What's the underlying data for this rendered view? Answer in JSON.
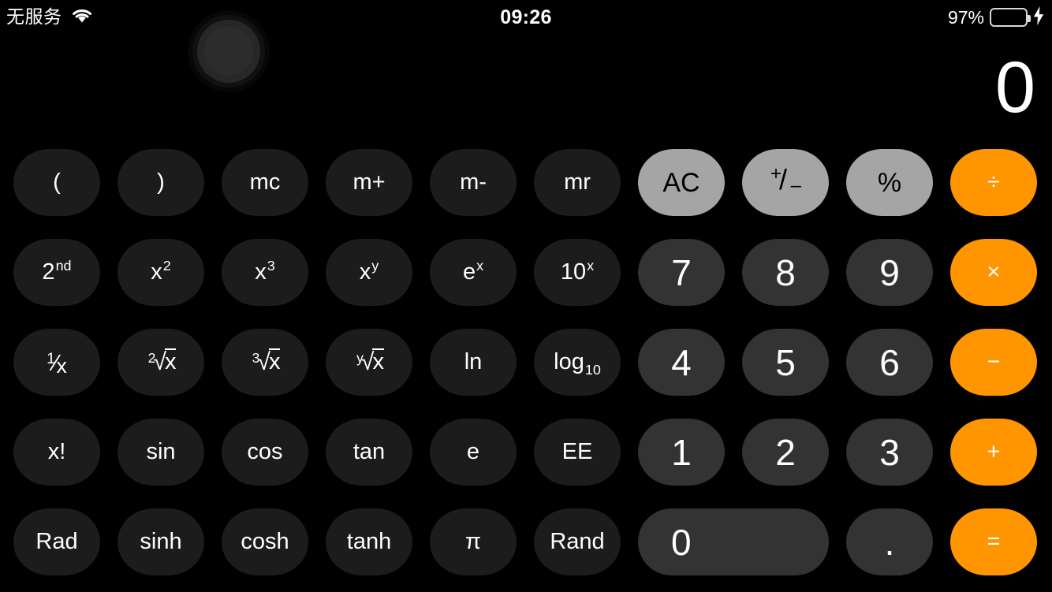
{
  "status_bar": {
    "carrier": "无服务",
    "wifi_icon": "wifi-icon",
    "time": "09:26",
    "battery_percent": "97%",
    "battery_level": 97,
    "battery_color": "#4cd551",
    "charging_icon": "lightning-bolt-icon",
    "charging": true
  },
  "assistive_touch": {
    "name": "assistive-touch-button"
  },
  "display": {
    "value": "0"
  },
  "theme": {
    "background": "#000000",
    "function_key": "#1c1c1c",
    "digit_key": "#333333",
    "utility_key": "#a5a5a5",
    "operator_key": "#ff9500",
    "text_light": "#ffffff",
    "text_dark": "#000000"
  },
  "keypad": {
    "rows": [
      {
        "keys": [
          {
            "name": "key-open-paren",
            "label": "(",
            "type": "fn"
          },
          {
            "name": "key-close-paren",
            "label": ")",
            "type": "fn"
          },
          {
            "name": "key-mc",
            "label": "mc",
            "type": "fn"
          },
          {
            "name": "key-m-plus",
            "label": "m+",
            "type": "fn"
          },
          {
            "name": "key-m-minus",
            "label": "m-",
            "type": "fn"
          },
          {
            "name": "key-mr",
            "label": "mr",
            "type": "fn"
          },
          {
            "name": "key-all-clear",
            "label": "AC",
            "type": "util"
          },
          {
            "name": "key-plus-minus",
            "label": "⁺∕₋",
            "type": "util"
          },
          {
            "name": "key-percent",
            "label": "%",
            "type": "util"
          },
          {
            "name": "key-divide",
            "label": "÷",
            "type": "op"
          }
        ]
      },
      {
        "keys": [
          {
            "name": "key-second",
            "label": "2nd",
            "type": "fn"
          },
          {
            "name": "key-x-squared",
            "label": "x²",
            "type": "fn"
          },
          {
            "name": "key-x-cubed",
            "label": "x³",
            "type": "fn"
          },
          {
            "name": "key-x-power-y",
            "label": "xʸ",
            "type": "fn"
          },
          {
            "name": "key-e-power-x",
            "label": "eˣ",
            "type": "fn"
          },
          {
            "name": "key-ten-power-x",
            "label": "10ˣ",
            "type": "fn"
          },
          {
            "name": "key-7",
            "label": "7",
            "type": "digit"
          },
          {
            "name": "key-8",
            "label": "8",
            "type": "digit"
          },
          {
            "name": "key-9",
            "label": "9",
            "type": "digit"
          },
          {
            "name": "key-multiply",
            "label": "×",
            "type": "op"
          }
        ]
      },
      {
        "keys": [
          {
            "name": "key-reciprocal",
            "label": "1/x",
            "type": "fn"
          },
          {
            "name": "key-sqrt",
            "label": "²√x",
            "type": "fn"
          },
          {
            "name": "key-cube-root",
            "label": "³√x",
            "type": "fn"
          },
          {
            "name": "key-y-root-x",
            "label": "ʸ√x",
            "type": "fn"
          },
          {
            "name": "key-ln",
            "label": "ln",
            "type": "fn"
          },
          {
            "name": "key-log10",
            "label": "log10",
            "type": "fn"
          },
          {
            "name": "key-4",
            "label": "4",
            "type": "digit"
          },
          {
            "name": "key-5",
            "label": "5",
            "type": "digit"
          },
          {
            "name": "key-6",
            "label": "6",
            "type": "digit"
          },
          {
            "name": "key-subtract",
            "label": "−",
            "type": "op"
          }
        ]
      },
      {
        "keys": [
          {
            "name": "key-factorial",
            "label": "x!",
            "type": "fn"
          },
          {
            "name": "key-sin",
            "label": "sin",
            "type": "fn"
          },
          {
            "name": "key-cos",
            "label": "cos",
            "type": "fn"
          },
          {
            "name": "key-tan",
            "label": "tan",
            "type": "fn"
          },
          {
            "name": "key-euler-e",
            "label": "e",
            "type": "fn"
          },
          {
            "name": "key-ee",
            "label": "EE",
            "type": "fn"
          },
          {
            "name": "key-1",
            "label": "1",
            "type": "digit"
          },
          {
            "name": "key-2",
            "label": "2",
            "type": "digit"
          },
          {
            "name": "key-3",
            "label": "3",
            "type": "digit"
          },
          {
            "name": "key-add",
            "label": "+",
            "type": "op"
          }
        ]
      },
      {
        "keys": [
          {
            "name": "key-rad",
            "label": "Rad",
            "type": "fn"
          },
          {
            "name": "key-sinh",
            "label": "sinh",
            "type": "fn"
          },
          {
            "name": "key-cosh",
            "label": "cosh",
            "type": "fn"
          },
          {
            "name": "key-tanh",
            "label": "tanh",
            "type": "fn"
          },
          {
            "name": "key-pi",
            "label": "π",
            "type": "fn"
          },
          {
            "name": "key-rand",
            "label": "Rand",
            "type": "fn"
          },
          {
            "name": "key-0",
            "label": "0",
            "type": "digit",
            "wide": true
          },
          {
            "name": "key-decimal",
            "label": ".",
            "type": "digit"
          },
          {
            "name": "key-equals",
            "label": "=",
            "type": "op"
          }
        ]
      }
    ]
  }
}
